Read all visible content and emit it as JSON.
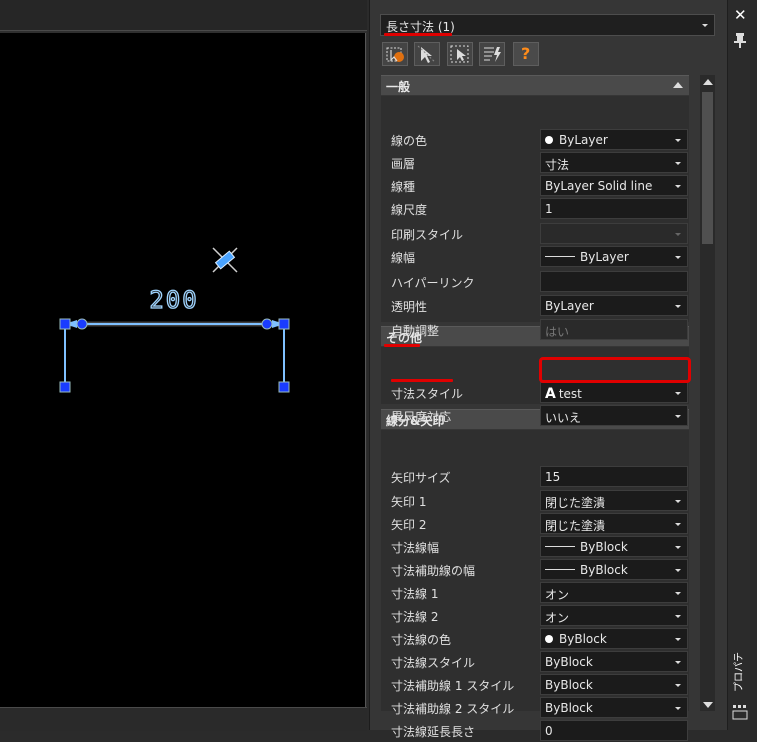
{
  "canvas": {
    "dimension_text": "200"
  },
  "panel": {
    "selector_label": "長さ寸法 (1)",
    "toolbar": [
      {
        "icon": "toggle-pickadd-icon"
      },
      {
        "icon": "select-objects-icon"
      },
      {
        "icon": "quick-select-icon"
      },
      {
        "icon": "filter-icon"
      },
      {
        "icon": "help-icon",
        "glyph": "?"
      }
    ],
    "sections": {
      "general": {
        "title": "一般",
        "rows": [
          {
            "label": "線の色",
            "value": "ByLayer",
            "kind": "dot"
          },
          {
            "label": "画層",
            "value": "寸法",
            "kind": "dropdown"
          },
          {
            "label": "線種",
            "value": "ByLayer     Solid line",
            "kind": "dropdown"
          },
          {
            "label": "線尺度",
            "value": "1",
            "kind": "text"
          },
          {
            "label": "印刷スタイル",
            "value": "",
            "kind": "disabled-dropdown"
          },
          {
            "label": "線幅",
            "value": "ByLayer",
            "kind": "dash"
          },
          {
            "label": "ハイパーリンク",
            "value": "",
            "kind": "text"
          },
          {
            "label": "透明性",
            "value": "ByLayer",
            "kind": "dropdown"
          },
          {
            "label": "自動調整",
            "value": "はい",
            "kind": "disabled"
          }
        ]
      },
      "other": {
        "title": "その他",
        "rows": [
          {
            "label": "寸法スタイル",
            "value": "test",
            "kind": "style"
          },
          {
            "label": "異尺度対応",
            "value": "いいえ",
            "kind": "dropdown"
          }
        ]
      },
      "lines_arrows": {
        "title": "線分&矢印",
        "rows": [
          {
            "label": "矢印サイズ",
            "value": "15",
            "kind": "text"
          },
          {
            "label": "矢印 1",
            "value": "閉じた塗潰",
            "kind": "dropdown"
          },
          {
            "label": "矢印 2",
            "value": "閉じた塗潰",
            "kind": "dropdown"
          },
          {
            "label": "寸法線幅",
            "value": "ByBlock",
            "kind": "dash"
          },
          {
            "label": "寸法補助線の幅",
            "value": "ByBlock",
            "kind": "dash"
          },
          {
            "label": "寸法線 1",
            "value": "オン",
            "kind": "dropdown"
          },
          {
            "label": "寸法線 2",
            "value": "オン",
            "kind": "dropdown"
          },
          {
            "label": "寸法線の色",
            "value": "ByBlock",
            "kind": "dot"
          },
          {
            "label": "寸法線スタイル",
            "value": "ByBlock",
            "kind": "dropdown"
          },
          {
            "label": "寸法補助線 1 スタイル",
            "value": "ByBlock",
            "kind": "dropdown"
          },
          {
            "label": "寸法補助線 2 スタイル",
            "value": "ByBlock",
            "kind": "dropdown"
          },
          {
            "label": "寸法線延長長さ",
            "value": "0",
            "kind": "text"
          }
        ]
      }
    }
  },
  "side_strip": {
    "tab_label": "プロパティ"
  },
  "colors": {
    "highlight": "#e00000",
    "dimension": "#5aa9ff",
    "grip": "#1a3cff"
  }
}
